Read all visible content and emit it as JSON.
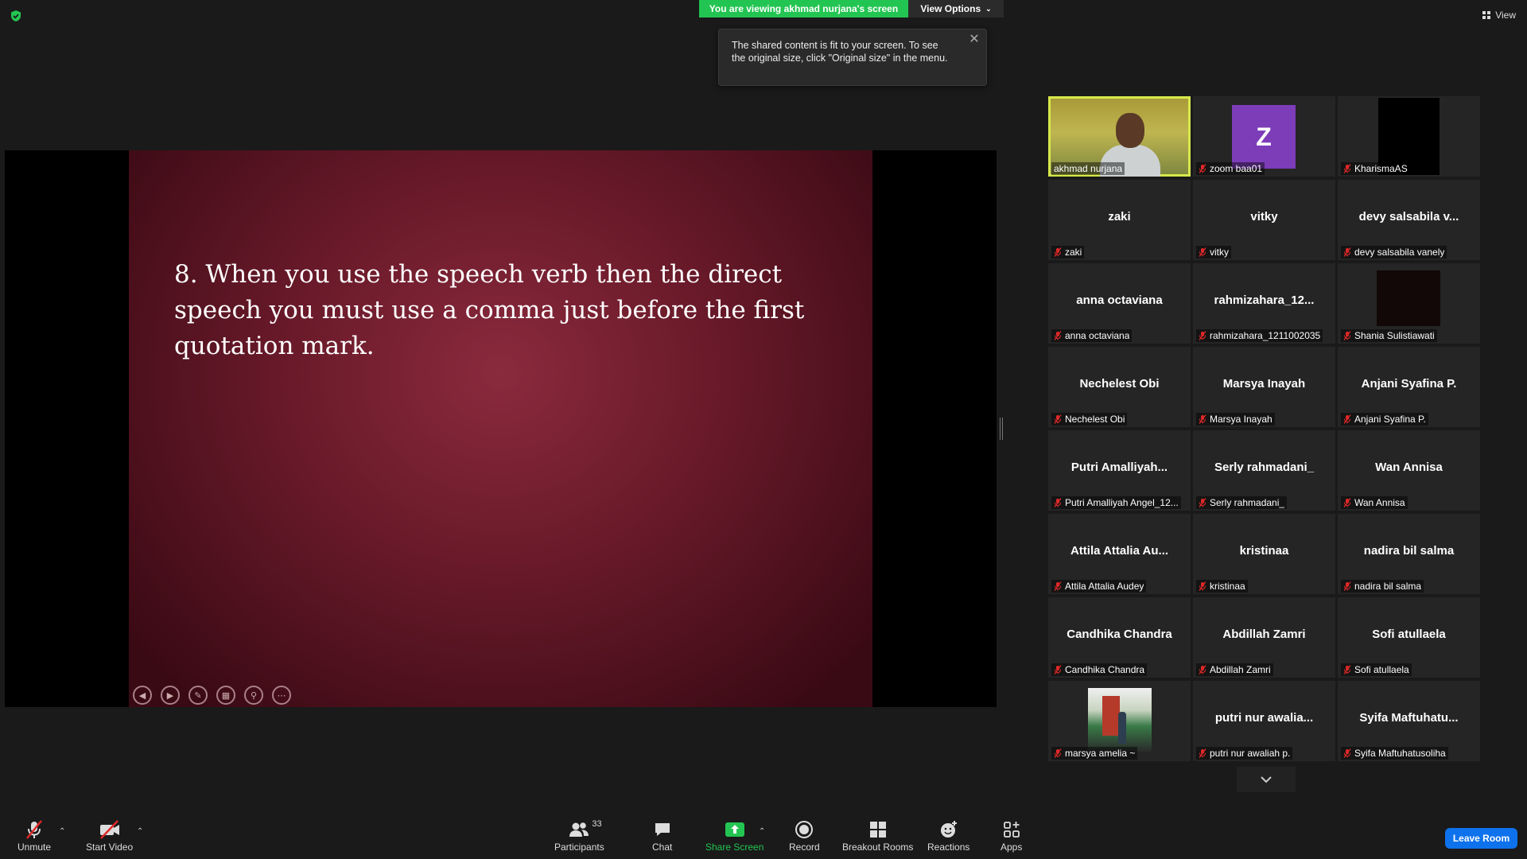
{
  "banner": {
    "viewing": "You are viewing akhmad nurjana's screen",
    "view_options": "View Options"
  },
  "top_right": {
    "view": "View"
  },
  "tooltip": {
    "text": "The shared content is fit to your screen. To see the original size, click \"Original size\" in the menu."
  },
  "slide": {
    "text": "8. When you use the speech verb then the direct speech you must use a comma just before the first quotation mark."
  },
  "gallery": {
    "tiles": [
      {
        "type": "video",
        "label": "akhmad nurjana",
        "active": true
      },
      {
        "type": "initial",
        "initial": "Z",
        "label": "zoom baa01"
      },
      {
        "type": "black",
        "label": "KharismaAS"
      },
      {
        "type": "name",
        "center": "zaki",
        "label": "zaki"
      },
      {
        "type": "name",
        "center": "vitky",
        "label": "vitky"
      },
      {
        "type": "name",
        "center": "devy  salsabila  v...",
        "label": "devy salsabila vanely"
      },
      {
        "type": "name",
        "center": "anna octaviana",
        "label": "anna octaviana"
      },
      {
        "type": "name",
        "center": "rahmizahara_12...",
        "label": "rahmizahara_1211002035"
      },
      {
        "type": "dark",
        "label": "Shania Sulistiawati"
      },
      {
        "type": "name",
        "center": "Nechelest Obi",
        "label": "Nechelest Obi"
      },
      {
        "type": "name",
        "center": "Marsya Inayah",
        "label": "Marsya Inayah"
      },
      {
        "type": "name",
        "center": "Anjani Syafina P.",
        "label": "Anjani Syafina P."
      },
      {
        "type": "name",
        "center": "Putri  Amalliyah...",
        "label": "Putri Amalliyah Angel_12..."
      },
      {
        "type": "name",
        "center": "Serly rahmadani_",
        "label": "Serly rahmadani_"
      },
      {
        "type": "name",
        "center": "Wan Annisa",
        "label": "Wan Annisa"
      },
      {
        "type": "name",
        "center": "Attila Attalia Au...",
        "label": "Attila Attalia Audey"
      },
      {
        "type": "name",
        "center": "kristinaa",
        "label": "kristinaa"
      },
      {
        "type": "name",
        "center": "nadira bil salma",
        "label": "nadira bil salma"
      },
      {
        "type": "name",
        "center": "Candhika Chandra",
        "label": "Candhika Chandra"
      },
      {
        "type": "name",
        "center": "Abdillah Zamri",
        "label": "Abdillah Zamri"
      },
      {
        "type": "name",
        "center": "Sofi atullaela",
        "label": "Sofi atullaela"
      },
      {
        "type": "photo",
        "label": "marsya amelia ~"
      },
      {
        "type": "name",
        "center": "putri  nur  awalia...",
        "label": "putri nur awaliah p."
      },
      {
        "type": "name",
        "center": "Syifa  Maftuhatu...",
        "label": "Syifa Maftuhatusoliha"
      }
    ]
  },
  "toolbar": {
    "unmute": "Unmute",
    "start_video": "Start Video",
    "participants": "Participants",
    "participants_count": "33",
    "chat": "Chat",
    "share_screen": "Share Screen",
    "record": "Record",
    "breakout_rooms": "Breakout Rooms",
    "reactions": "Reactions",
    "apps": "Apps",
    "leave": "Leave Room"
  },
  "colors": {
    "share_green": "#23c552",
    "leave_blue": "#0e72ed",
    "active_border": "#d6e84c"
  }
}
